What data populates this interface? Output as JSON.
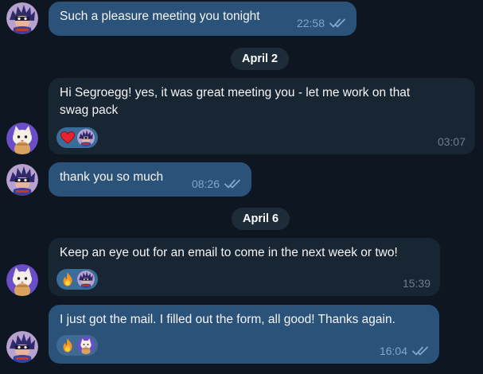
{
  "messages": [
    {
      "text": "Such a pleasure meeting you tonight",
      "time": "22:58"
    },
    {
      "text": "Hi Segroegg! yes, it was great meeting you - let me work on that\nswag pack",
      "time": "03:07"
    },
    {
      "text": "thank you so much",
      "time": "08:26"
    },
    {
      "text": "Keep an eye out for an email to come in the next week or two!",
      "time": "15:39"
    },
    {
      "text": "I just got the mail. I filled out the form, all good! Thanks again.",
      "time": "16:04"
    }
  ],
  "dates": [
    "April 2",
    "April 6"
  ],
  "colors": {
    "background": "#0e1621",
    "outgoing_bubble": "#2b5278",
    "incoming_bubble": "#182533",
    "date_pill": "#1e2c3a",
    "read_ticks": "#7da8d3"
  },
  "reactions": {
    "message_2": [
      "heart-emoji",
      "user-avatar"
    ],
    "message_4": [
      "fire-emoji",
      "user-avatar"
    ],
    "message_5": [
      "fire-emoji",
      "contact-avatar"
    ]
  },
  "icons": [
    "double-check-icon",
    "heart-icon",
    "fire-icon",
    "avatar-spiky-hair",
    "avatar-cat"
  ]
}
